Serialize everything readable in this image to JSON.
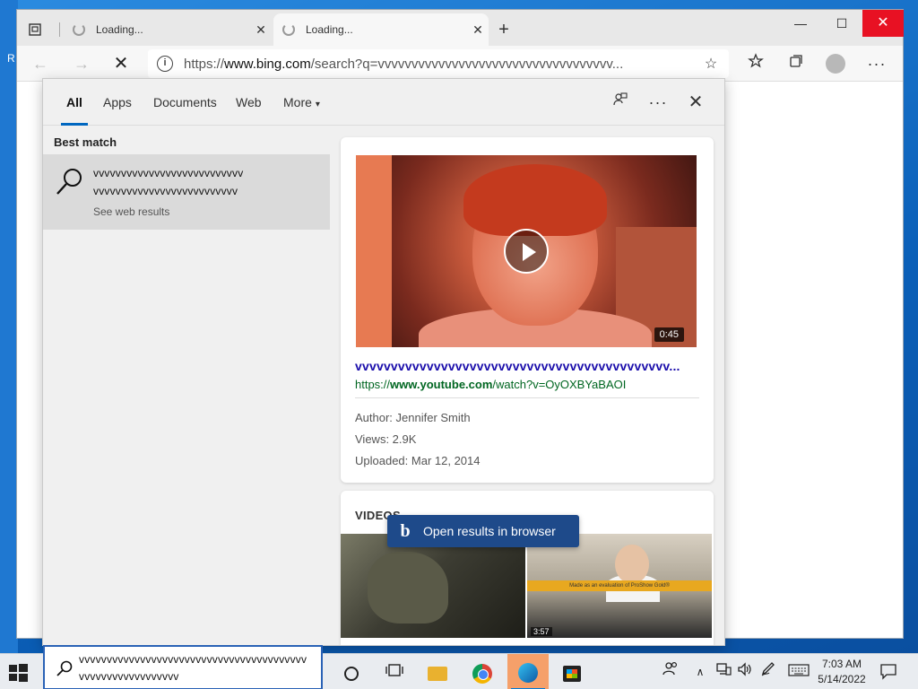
{
  "desktop": {
    "edge_letter": "R"
  },
  "browser": {
    "tabs": [
      {
        "label": "Loading..."
      },
      {
        "label": "Loading..."
      }
    ],
    "new_tab": "+",
    "window": {
      "minimize": "—",
      "maximize": "☐",
      "close": "✕"
    },
    "toolbar": {
      "back": "←",
      "forward": "→",
      "stop": "✕",
      "url_prefix": "https://",
      "url_host": "www.bing.com",
      "url_rest": "/search?q=vvvvvvvvvvvvvvvvvvvvvvvvvvvvvvvvvvv...",
      "more": "···"
    }
  },
  "search_flyout": {
    "tabs": [
      {
        "label": "All",
        "active": true
      },
      {
        "label": "Apps"
      },
      {
        "label": "Documents"
      },
      {
        "label": "Web"
      },
      {
        "label": "More"
      }
    ],
    "more_caret": "▾",
    "header_icons": {
      "more": "···",
      "close": "✕"
    },
    "best_match_label": "Best match",
    "best_match": {
      "line1": "vvvvvvvvvvvvvvvvvvvvvvvvvvv",
      "line2": "vvvvvvvvvvvvvvvvvvvvvvvvvv",
      "subtitle": "See web results"
    },
    "video_card": {
      "duration": "0:45",
      "title": "vvvvvvvvvvvvvvvvvvvvvvvvvvvvvvvvvvvvvvvvvvvv...",
      "url_prefix": "https://",
      "url_host": "www.youtube.com",
      "url_rest": "/watch?v=OyOXBYaBAOI",
      "author": "Author: Jennifer Smith",
      "views": "Views: 2.9K",
      "uploaded": "Uploaded: Mar 12, 2014"
    },
    "videos_section": {
      "label": "VIDEOS",
      "thumb2_banner": "Made as an evaluation of ProShow Gold®",
      "thumb2_duration": "3:57"
    },
    "open_in_browser": {
      "logo": "b",
      "label": "Open results in browser"
    }
  },
  "taskbar": {
    "search_line1": "vvvvvvvvvvvvvvvvvvvvvvvvvvvvvvvvvvvvvvvvv",
    "search_line2": "vvvvvvvvvvvvvvvvvv",
    "tray_up": "∧",
    "time": "7:03 AM",
    "date": "5/14/2022"
  },
  "colors": {
    "accent": "#0067c0",
    "close_red": "#e81123",
    "link_title": "#1a0dab",
    "link_url": "#006621",
    "open_button": "#1e4a8a"
  }
}
